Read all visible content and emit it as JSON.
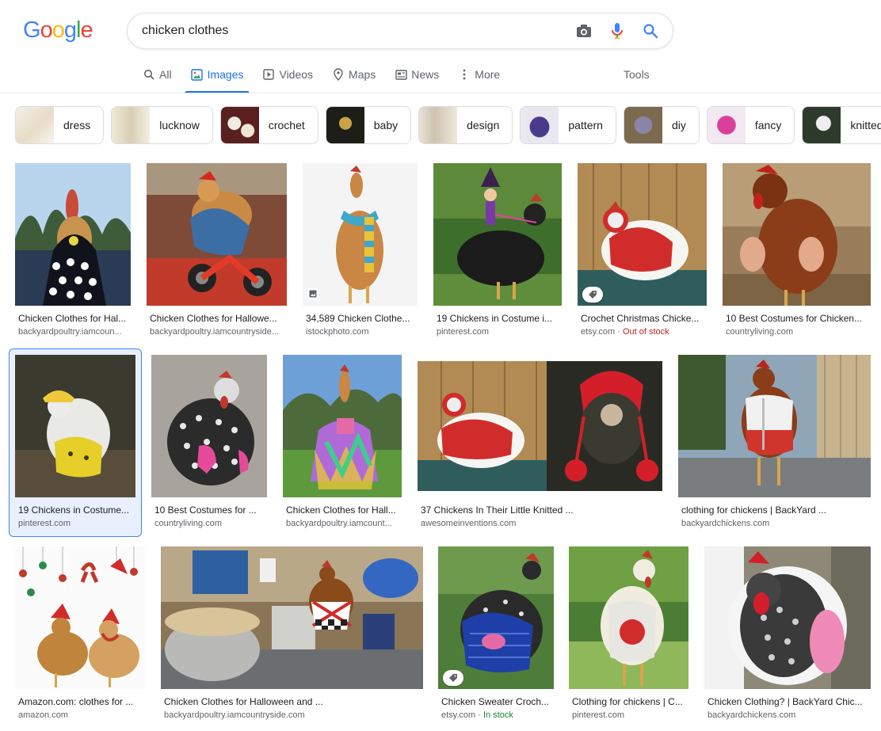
{
  "logo": {
    "letters": [
      "G",
      "o",
      "o",
      "g",
      "l",
      "e"
    ],
    "colors": [
      "#4285f4",
      "#ea4335",
      "#fbbc05",
      "#4285f4",
      "#34a853",
      "#ea4335"
    ]
  },
  "search": {
    "query": "chicken clothes",
    "placeholder": ""
  },
  "tabs": [
    {
      "label": "All",
      "icon": "search-icon"
    },
    {
      "label": "Images",
      "icon": "image-icon",
      "active": true
    },
    {
      "label": "Videos",
      "icon": "play-icon"
    },
    {
      "label": "Maps",
      "icon": "map-pin-icon"
    },
    {
      "label": "News",
      "icon": "news-icon"
    },
    {
      "label": "More",
      "icon": "more-vert-icon"
    }
  ],
  "tools": "Tools",
  "chips": [
    "dress",
    "lucknow",
    "crochet",
    "baby",
    "design",
    "pattern",
    "diy",
    "fancy",
    "knitted"
  ],
  "results": [
    {
      "title": "Chicken Clothes for Hal...",
      "site": "backyardpoultry.iamcoun..."
    },
    {
      "title": "Chicken Clothes for Hallowe...",
      "site": "backyardpoultry.iamcountryside..."
    },
    {
      "title": "34,589 Chicken Clothe...",
      "site": "istockphoto.com"
    },
    {
      "title": "19 Chickens in Costume i...",
      "site": "pinterest.com"
    },
    {
      "title": "Crochet Christmas Chicke...",
      "site": "etsy.com",
      "status": "Out of stock"
    },
    {
      "title": "10 Best Costumes for Chicken...",
      "site": "countryliving.com"
    },
    {
      "title": "19 Chickens in Costume...",
      "site": "pinterest.com"
    },
    {
      "title": "10 Best Costumes for ...",
      "site": "countryliving.com"
    },
    {
      "title": "Chicken Clothes for Hall...",
      "site": "backyardpoultry.iamcount..."
    },
    {
      "title": "37 Chickens In Their Little Knitted ...",
      "site": "awesomeinventions.com"
    },
    {
      "title": "clothing for chickens | BackYard ...",
      "site": "backyardchickens.com"
    },
    {
      "title": "Amazon.com: clothes for ...",
      "site": "amazon.com"
    },
    {
      "title": "Chicken Clothes for Halloween and ...",
      "site": "backyardpoultry.iamcountryside.com"
    },
    {
      "title": "Chicken Sweater Croch...",
      "site": "etsy.com",
      "status": "In stock"
    },
    {
      "title": "Clothing for chickens | C...",
      "site": "pinterest.com"
    },
    {
      "title": "Chicken Clothing? | BackYard Chic...",
      "site": "backyardchickens.com"
    }
  ],
  "colors": {
    "accent": "#1a73e8",
    "out_of_stock": "#c5221f",
    "in_stock": "#188038"
  }
}
